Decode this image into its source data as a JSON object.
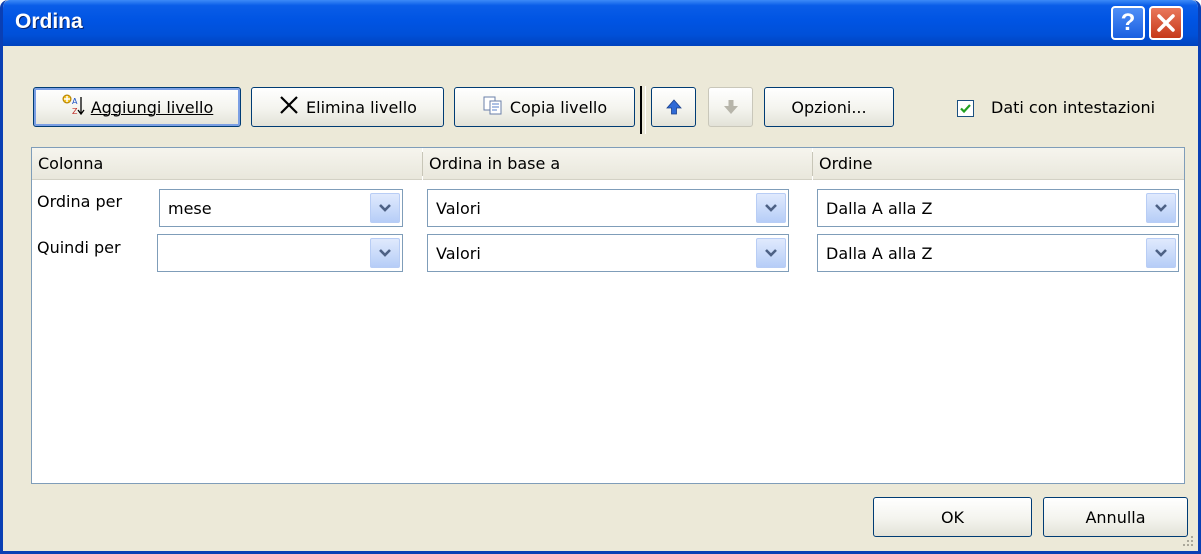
{
  "window": {
    "title": "Ordina"
  },
  "toolbar": {
    "add_level": "Aggiungi livello",
    "delete_level": "Elimina livello",
    "copy_level": "Copia livello",
    "options": "Opzioni...",
    "headers_checkbox_label": "Dati con intestazioni",
    "headers_checked": true
  },
  "grid": {
    "headers": [
      "Colonna",
      "Ordina in base a",
      "Ordine"
    ],
    "rows": [
      {
        "label": "Ordina per",
        "column": "mese",
        "sort_on": "Valori",
        "order": "Dalla A alla Z"
      },
      {
        "label": "Quindi per",
        "column": "",
        "sort_on": "Valori",
        "order": "Dalla A alla Z"
      }
    ]
  },
  "footer": {
    "ok": "OK",
    "cancel": "Annulla"
  },
  "colors": {
    "titlebar": "#0054e3",
    "face": "#ece9d8",
    "accent": "#7b9fe4"
  }
}
